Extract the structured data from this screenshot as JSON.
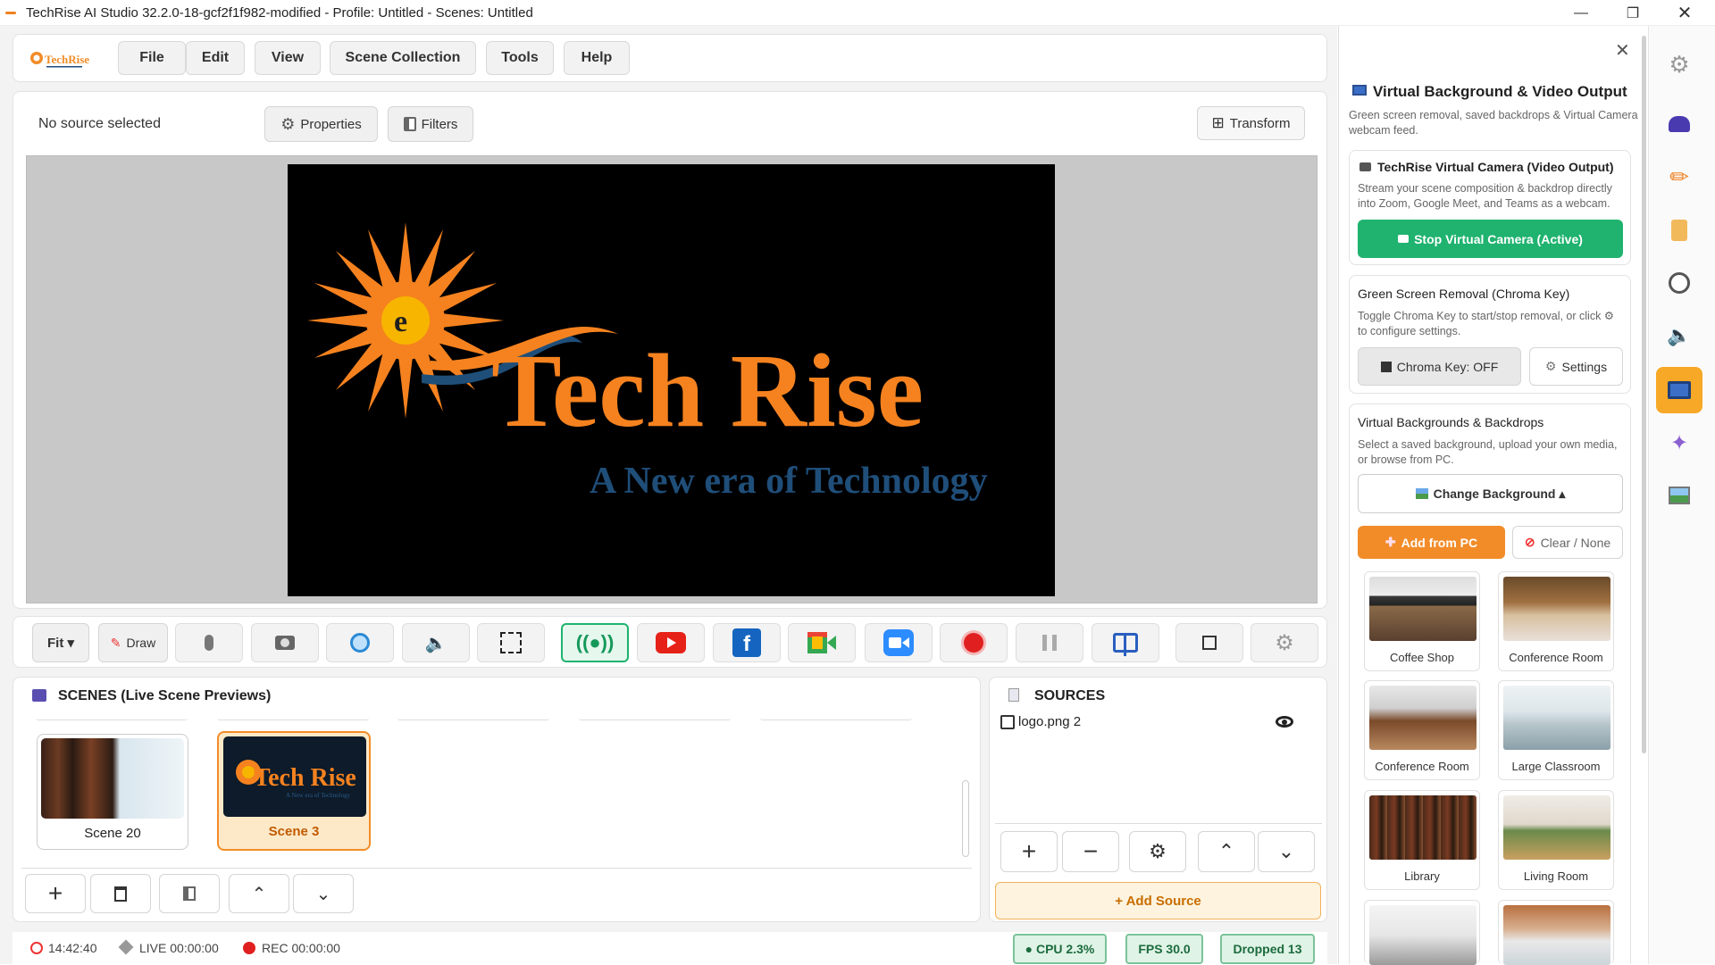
{
  "window": {
    "title": "TechRise AI Studio 32.2.0-18-gcf2f1f982-modified - Profile: Untitled - Scenes: Untitled"
  },
  "menu": {
    "logo_text": "TechRise",
    "items": [
      "File",
      "Edit",
      "View",
      "Scene Collection",
      "Tools",
      "Help"
    ]
  },
  "source_bar": {
    "status": "No source selected",
    "properties": "Properties",
    "filters": "Filters",
    "transform": "Transform"
  },
  "preview": {
    "brand": "Tech Rise",
    "tagline": "A New era of Technology"
  },
  "toolbar": {
    "fit": "Fit ▾",
    "draw": "Draw"
  },
  "scenes": {
    "header": "SCENES (Live Scene Previews)",
    "items": [
      {
        "label": "Scene 20",
        "selected": false
      },
      {
        "label": "Scene 3",
        "selected": true
      }
    ],
    "thumb_brand": "Tech Rise",
    "thumb_tag": "A New era of Technology"
  },
  "sources": {
    "header": "SOURCES",
    "items": [
      {
        "label": "logo.png 2"
      }
    ],
    "add": "+ Add Source"
  },
  "status": {
    "time": "14:42:40",
    "live": "LIVE 00:00:00",
    "rec": "REC 00:00:00",
    "cpu": "● CPU 2.3%",
    "fps": "FPS 30.0",
    "dropped": "Dropped 13"
  },
  "panel": {
    "title": "Virtual Background & Video Output",
    "subtitle": "Green screen removal, saved backdrops & Virtual Camera webcam feed.",
    "vcam": {
      "title": "TechRise Virtual Camera (Video Output)",
      "desc": "Stream your scene composition & backdrop directly into Zoom, Google Meet, and Teams as a webcam.",
      "button": "Stop Virtual Camera (Active)"
    },
    "chroma": {
      "title": "Green Screen Removal (Chroma Key)",
      "desc": "Toggle Chroma Key to start/stop removal, or click ⚙ to configure settings.",
      "toggle": "Chroma Key: OFF",
      "settings": "Settings"
    },
    "vbg": {
      "title": "Virtual Backgrounds & Backdrops",
      "desc": "Select a saved background, upload your own media, or browse from PC.",
      "change": "Change Background ▴",
      "add": "Add from PC",
      "clear": "Clear / None"
    },
    "backgrounds": [
      "Coffee Shop",
      "Conference Room",
      "Conference Room",
      "Large Classroom",
      "Library",
      "Living Room"
    ]
  },
  "colors": {
    "accent_orange": "#f28c28",
    "green": "#1fb36f",
    "brand_orange": "#f5821f",
    "brand_blue": "#1f4e79"
  }
}
